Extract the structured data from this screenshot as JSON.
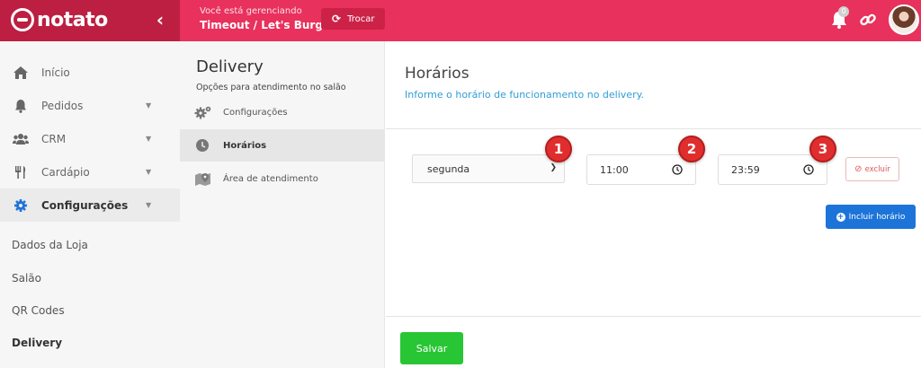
{
  "app": {
    "brand": "notato",
    "managing_hint": "Você está gerenciando",
    "store_name": "Timeout / Let's Burger",
    "swap_label": "Trocar",
    "notification_count": "0"
  },
  "sidebar": {
    "items": [
      {
        "label": "Início",
        "icon": "home-icon"
      },
      {
        "label": "Pedidos",
        "icon": "bell-icon"
      },
      {
        "label": "CRM",
        "icon": "users-icon"
      },
      {
        "label": "Cardápio",
        "icon": "utensils-icon"
      },
      {
        "label": "Configurações",
        "icon": "gear-icon"
      }
    ],
    "sub_items": [
      "Dados da Loja",
      "Salão",
      "QR Codes",
      "Delivery"
    ]
  },
  "panel": {
    "title": "Delivery",
    "subtitle": "Opções para atendimento no salão",
    "items": [
      {
        "label": "Configurações",
        "icon": "cogs-icon"
      },
      {
        "label": "Horários",
        "icon": "clock-icon"
      },
      {
        "label": "Área de atendimento",
        "icon": "map-icon"
      }
    ]
  },
  "main": {
    "title": "Horários",
    "subtitle": "Informe o horário de funcionamento no delivery.",
    "schedule": {
      "day": "segunda",
      "open": "11:00",
      "close": "23:59",
      "remove_label": "excluir"
    },
    "add_label": "Incluir horário",
    "save_label": "Salvar"
  },
  "markers": [
    "1",
    "2",
    "3"
  ],
  "colors": {
    "topbar": "#e8315c",
    "brand_bg": "#bc1f41",
    "primary": "#1d74d8",
    "success": "#28c634",
    "danger": "#e05858",
    "marker": "#e02e2e"
  }
}
